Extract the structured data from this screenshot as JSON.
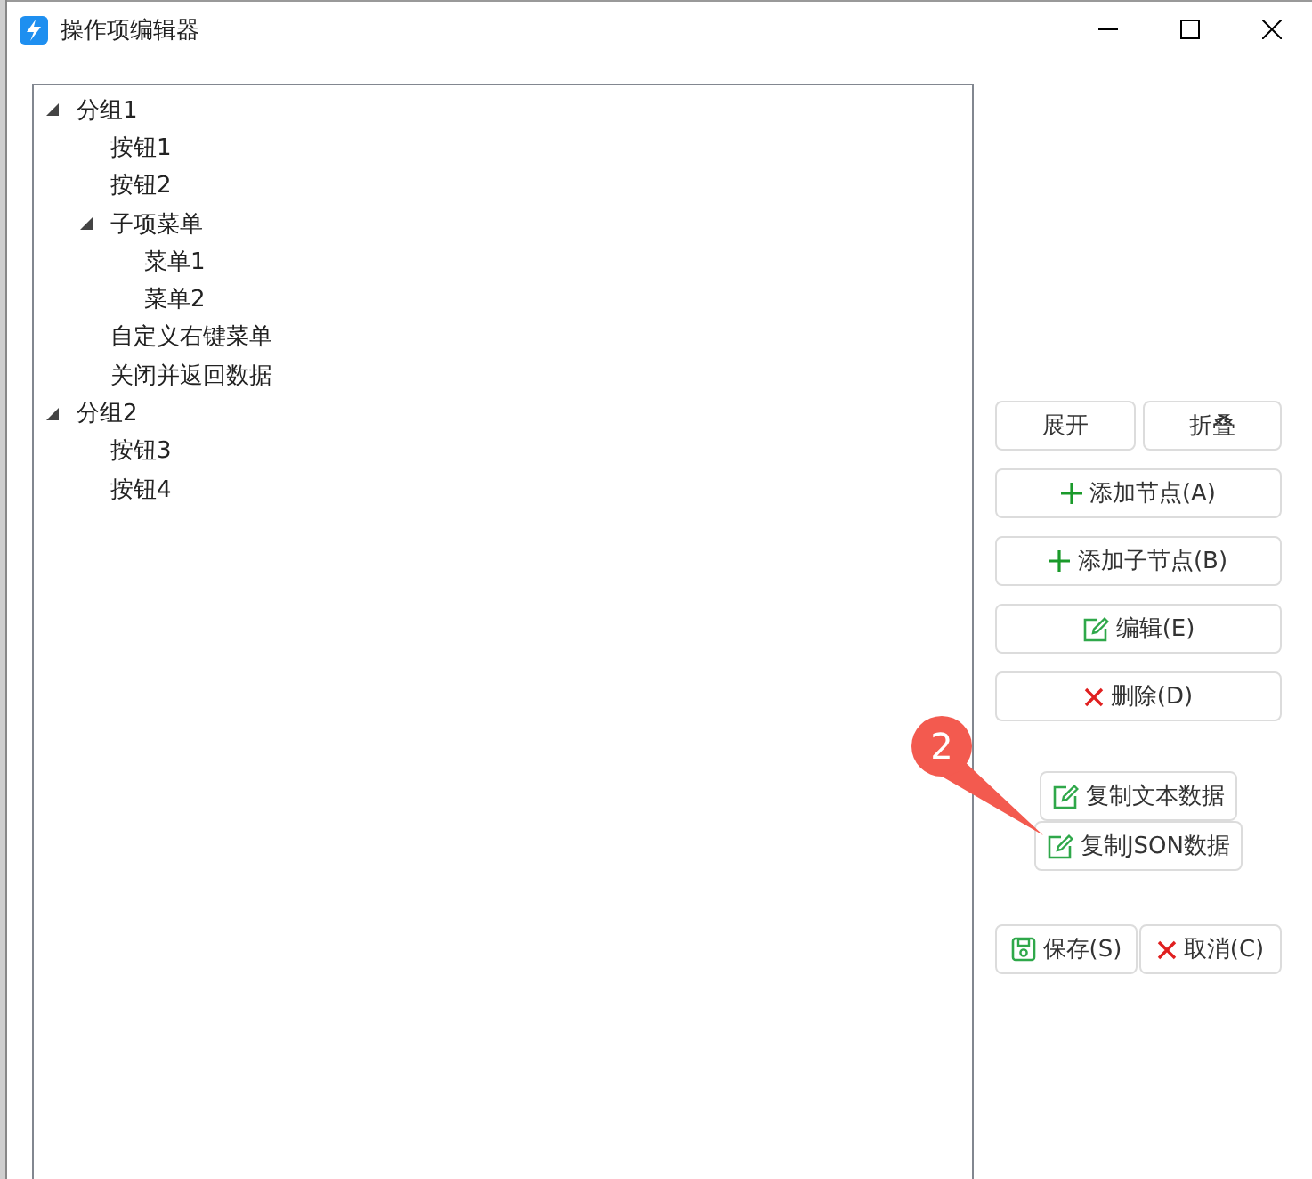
{
  "window": {
    "title": "操作项编辑器"
  },
  "tree": [
    {
      "label": "分组1",
      "expanded": true,
      "children": [
        {
          "label": "按钮1"
        },
        {
          "label": "按钮2"
        },
        {
          "label": "子项菜单",
          "expanded": true,
          "children": [
            {
              "label": "菜单1"
            },
            {
              "label": "菜单2"
            }
          ]
        },
        {
          "label": "自定义右键菜单"
        },
        {
          "label": "关闭并返回数据"
        }
      ]
    },
    {
      "label": "分组2",
      "expanded": true,
      "children": [
        {
          "label": "按钮3"
        },
        {
          "label": "按钮4"
        }
      ]
    }
  ],
  "button_groups": [
    [
      {
        "label": "展开",
        "kind": "plain"
      },
      {
        "label": "折叠",
        "kind": "plain"
      }
    ],
    [
      {
        "label": "添加节点(A)",
        "kind": "add"
      }
    ],
    [
      {
        "label": "添加子节点(B)",
        "kind": "add"
      }
    ],
    [
      {
        "label": "编辑(E)",
        "kind": "edit"
      }
    ],
    [
      {
        "label": "删除(D)",
        "kind": "delete"
      }
    ]
  ],
  "copy_buttons": [
    {
      "label": "复制文本数据",
      "kind": "edit"
    },
    {
      "label": "复制JSON数据",
      "kind": "edit"
    }
  ],
  "footer_buttons": [
    {
      "label": "保存(S)",
      "kind": "save"
    },
    {
      "label": "取消(C)",
      "kind": "delete"
    }
  ],
  "callout": {
    "label": "2"
  }
}
